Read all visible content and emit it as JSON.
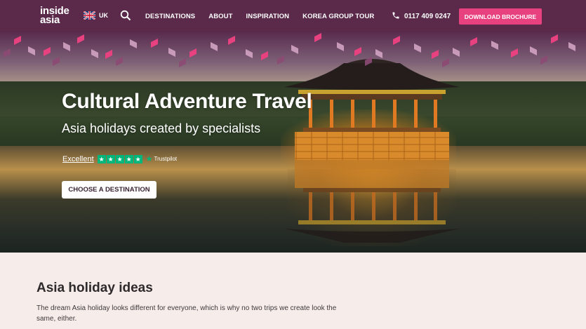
{
  "header": {
    "logo": {
      "line1": "inside",
      "line2": "asia"
    },
    "region": "UK",
    "nav": [
      "DESTINATIONS",
      "ABOUT",
      "INSPIRATION",
      "KOREA GROUP TOUR"
    ],
    "phone": "0117 409 0247",
    "cta": "DOWNLOAD BROCHURE"
  },
  "hero": {
    "title": "Cultural Adventure Travel",
    "subtitle": "Asia holidays created by specialists",
    "rating_word": "Excellent",
    "stars": 5,
    "trustpilot": "Trustpilot",
    "button": "CHOOSE A DESTINATION"
  },
  "ideas": {
    "heading": "Asia holiday ideas",
    "body": "The dream Asia holiday looks different for everyone, which is why no two trips we create look the same, either."
  },
  "colors": {
    "header_bg": "#5b2a4b",
    "accent_pink": "#e8417f",
    "trustpilot_green": "#00b67a",
    "page_bg": "#f6ecea"
  },
  "icons": [
    "uk-flag-icon",
    "search-icon",
    "phone-icon",
    "trustpilot-star-icon"
  ]
}
